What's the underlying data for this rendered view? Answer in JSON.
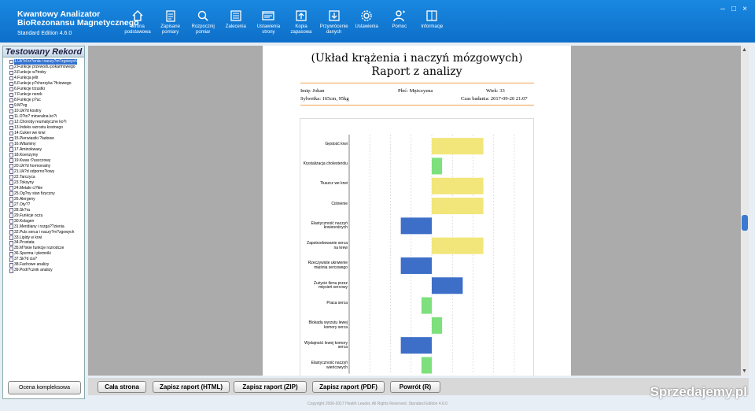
{
  "app": {
    "title_line1": "Kwantowy Analizator",
    "title_line2": "BioRezonansu Magnetycznego",
    "edition": "Standard Edition 4.6.0"
  },
  "nav": [
    {
      "label": "Strona podstawowa",
      "icon": "home-icon"
    },
    {
      "label": "Zapisane pomiary",
      "icon": "clipboard-icon"
    },
    {
      "label": "Rozpocznij pomiar",
      "icon": "search-icon"
    },
    {
      "label": "Zalecenia",
      "icon": "list-icon"
    },
    {
      "label": "Ustawienia strony",
      "icon": "window-icon"
    },
    {
      "label": "Kopia zapasowa",
      "icon": "upload-icon"
    },
    {
      "label": "Przywrócenie danych",
      "icon": "download-icon"
    },
    {
      "label": "Ustawienia",
      "icon": "gear-icon"
    },
    {
      "label": "Pomoc",
      "icon": "user-icon"
    },
    {
      "label": "Informacje",
      "icon": "book-icon"
    }
  ],
  "window_controls": {
    "minimize": "–",
    "maximize": "□",
    "close": "×"
  },
  "tree": {
    "title": "Testowany Rekord",
    "items": [
      "1.Uk?d kr?enia i naczy?m?zgowych",
      "2.Funkcje przewodu pokarmowego",
      "3.Funkcje w?troby",
      "4.Funkcja jelit",
      "5.Funkcje p?cherzyka ?fciowego",
      "6.Funkcje trzustki",
      "7.Funkcje nerek",
      "8.Funkcje p?uc",
      "9.M?zg",
      "10.Uk?d kostny",
      "11.O?to? mineralna ko?i",
      "12.Choroby reumatyczne ko?i",
      "13.Indeks wzrostu kostnego",
      "14.Cukier we krwi",
      "15.Pierwiastki ?ladowe",
      "16.Witaminy",
      "17.Aminokwasy",
      "18.Koenzymy",
      "19.Kwas t?uszczowy",
      "20.Uk?d hormonalny",
      "21.Uk?d odporno?iowy",
      "22.Tarczyca",
      "23.Toksyny",
      "24.Metale ci?kie",
      "25.Og?ny stan fizyczny",
      "26.Alergeny",
      "27.Oty??",
      "28.Sk?ra",
      "29.Funkcje oczu",
      "30.Kolagen",
      "31.Meridiany i rozga??zienia",
      "32.Puls serca i naczy?m?zgowych",
      "33.Lipidy w krwi",
      "34.Prostata",
      "35.M?skie funkcje rozrodcze",
      "36.Sperma i plemniki",
      "37.Sk?d cia?",
      "38.Fachowe analizy",
      "39.Podr?cznik analizy"
    ],
    "selected": 0
  },
  "sidebar_button": "Ocena kompleksowa",
  "report": {
    "title_line1": "(Układ krążenia i naczyń mózgowych)",
    "title_line2": "Raport z analizy",
    "name": "Imię: Johan",
    "sex": "Płeć: Mężczyzna",
    "age": "Wiek: 33",
    "figure": "Sylwetka: 165cm, 95kg",
    "date": "Czas badania: 2017-09-20 21:07"
  },
  "chart_data": {
    "type": "bar",
    "orientation": "horizontal",
    "categories": [
      "Gęstość krwi",
      "Krystalizacja cholesterolu",
      "Tłuszcz we krwi",
      "Ciśnienie",
      "Elastyczność naczyń krwionośnych",
      "Zapotrzebowanie serca na krew",
      "Rzeczywiste ukrwienie mięśnia sercowego",
      "Zużycie tlenu przez mięsień sercowy",
      "Praca serca",
      "Blokada wyrzutu lewej komory serca",
      "Wydajność lewej komory serca",
      "Elastyczność naczyń wieńcowych"
    ],
    "values": [
      1.0,
      0.2,
      1.0,
      1.0,
      -0.6,
      1.0,
      -0.6,
      0.6,
      -0.2,
      0.2,
      -0.6,
      -0.2
    ],
    "colors": [
      "#f2e67a",
      "#7de07d",
      "#f2e67a",
      "#f2e67a",
      "#3d6fc8",
      "#f2e67a",
      "#3d6fc8",
      "#3d6fc8",
      "#7de07d",
      "#7de07d",
      "#3d6fc8",
      "#7de07d"
    ],
    "xlim": [
      -1.6,
      1.6
    ],
    "grid": true
  },
  "buttons": [
    "Cała strona",
    "Zapisz raport (HTML)",
    "Zapisz raport (ZIP)",
    "Zapisz raport (PDF)",
    "Powrót (R)"
  ],
  "copyright": "Copyright 2006-2017 Health Leader, All Rights Reserved. Standard Edition 4.6.0",
  "watermark": "Sprzedajemy.pl"
}
